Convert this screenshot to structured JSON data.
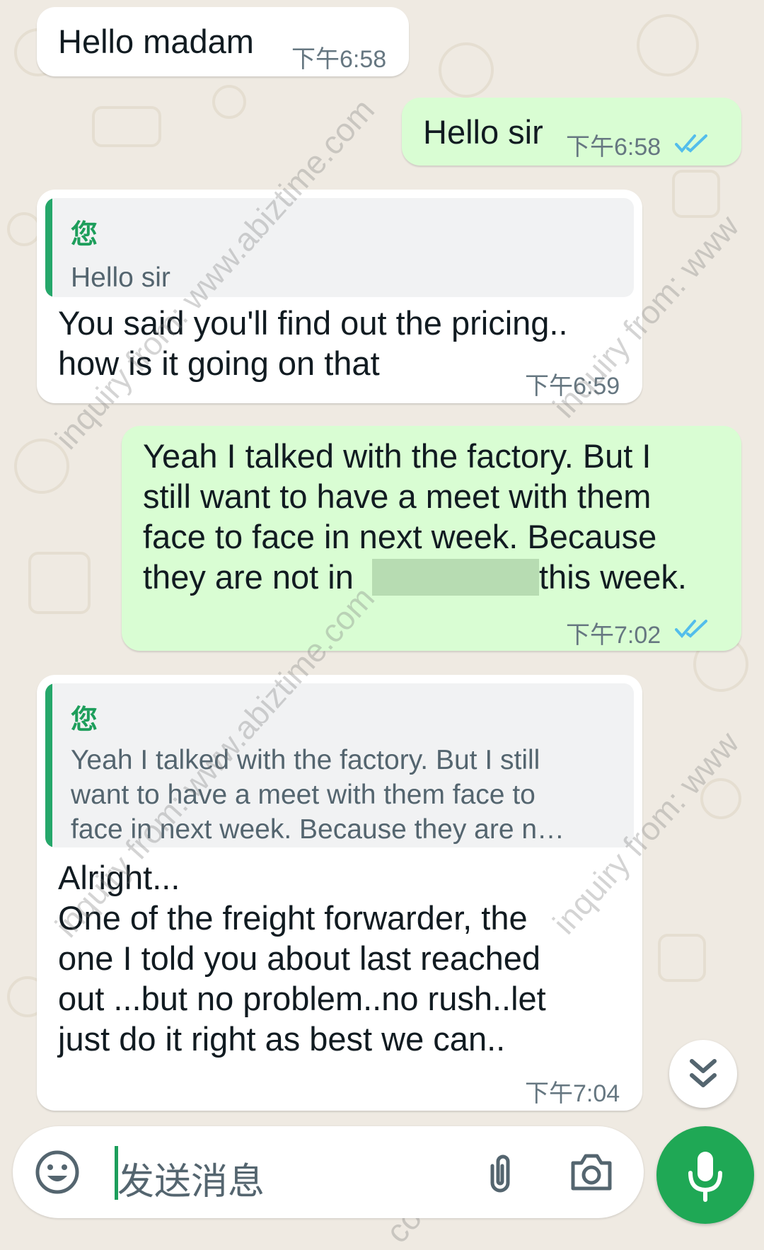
{
  "chat": {
    "messages": [
      {
        "direction": "incoming",
        "text": "Hello madam",
        "time": "下午6:58"
      },
      {
        "direction": "outgoing",
        "text": "Hello sir",
        "time": "下午6:58",
        "status": "read"
      },
      {
        "direction": "incoming",
        "quote": {
          "author": "您",
          "text": "Hello sir"
        },
        "text": "You said you'll find out the pricing..\nhow is it going on that",
        "time": "下午6:59"
      },
      {
        "direction": "outgoing",
        "text_before": "Yeah I talked with the factory. But I\nstill want to  have a meet with them\nface to face in next week. Because\nthey are not in",
        "text_after": "this week.",
        "time": "下午7:02",
        "status": "read"
      },
      {
        "direction": "incoming",
        "quote": {
          "author": "您",
          "text": "Yeah I talked with the factory. But I still\nwant to  have a meet with them face to\nface in next week. Because they are n…"
        },
        "text": "Alright...\nOne of the freight forwarder, the\none I told you about last reached\nout ...but no problem..no rush..let\njust do it right as best we can..",
        "time": "下午7:04"
      }
    ]
  },
  "watermarks": [
    "inquiry from: www.abiztime.com",
    "inquiry from: www",
    "inquiry from: www.abiztime.com",
    "inquiry from: www",
    "com"
  ],
  "composer": {
    "placeholder": "发送消息"
  },
  "icons": {
    "emoji": "emoji-icon",
    "attach": "paperclip-icon",
    "camera": "camera-icon",
    "mic": "mic-icon",
    "scroll": "double-chevron-down-icon",
    "read": "double-check-icon"
  },
  "colors": {
    "incoming_bubble": "#ffffff",
    "outgoing_bubble": "#d9fdd3",
    "accent": "#1fa855",
    "read_ticks": "#53bdeb",
    "background": "#efeae2"
  }
}
